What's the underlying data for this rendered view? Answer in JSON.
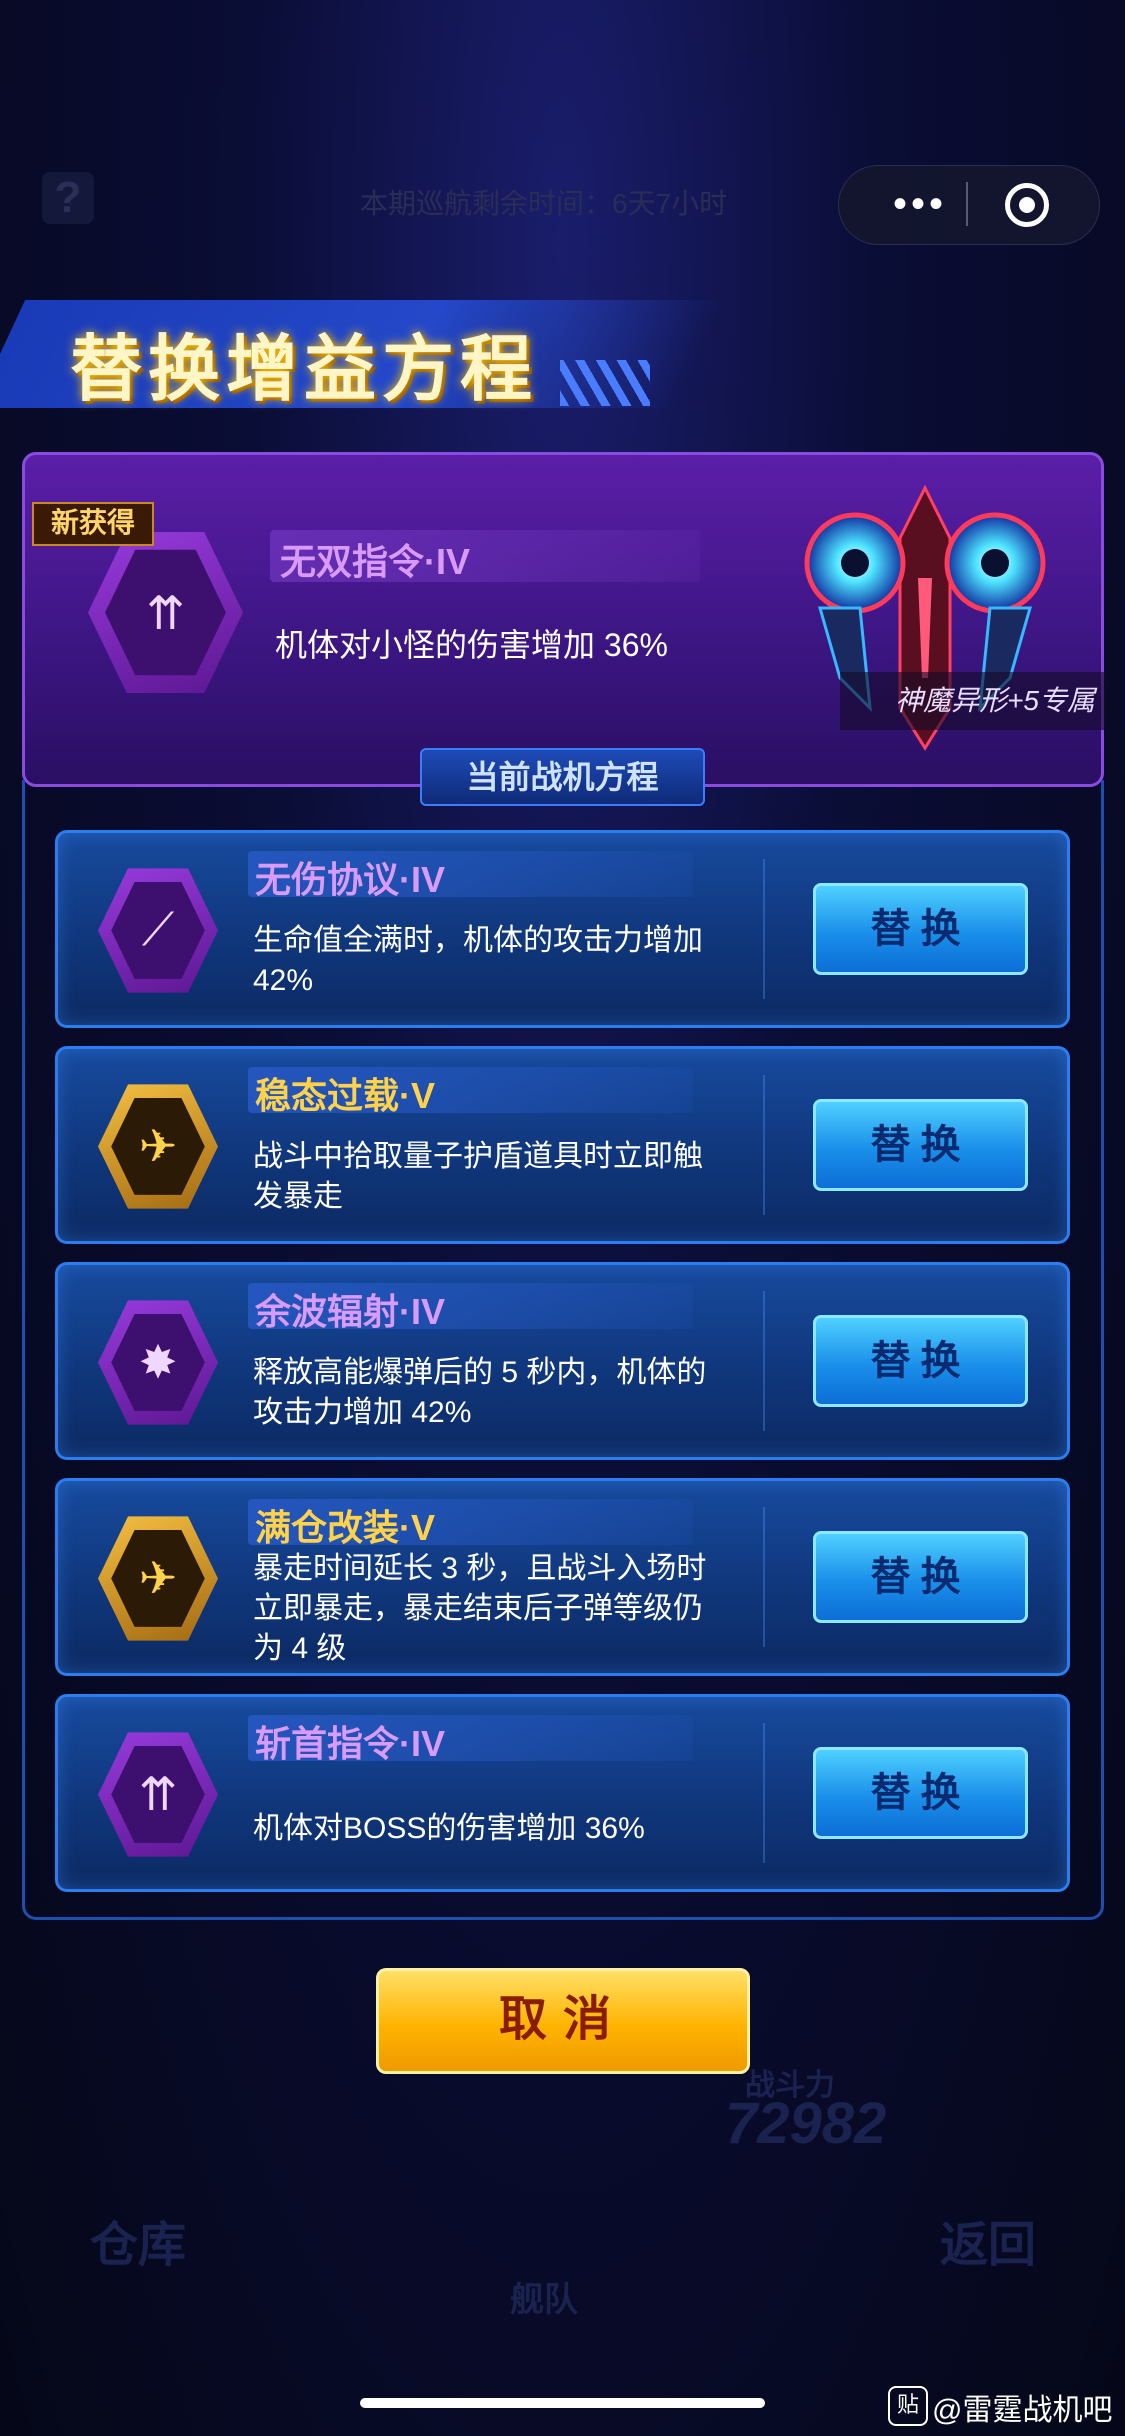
{
  "top_bar": {
    "help_glyph": "?",
    "cruise_text": "本期巡航剩余时间：6天7小时",
    "more_glyph": "•••"
  },
  "title": "替换增益方程",
  "new_item": {
    "tag": "新获得",
    "name": "无双指令·IV",
    "desc": "机体对小怪的伤害增加 36%",
    "ship_caption": "神魔异形+5专属",
    "icon": "fighter-arrows-icon"
  },
  "current_section_title": "当前战机方程",
  "cards": [
    {
      "name": "无伤协议·IV",
      "desc": "生命值全满时，机体的攻击力增加 42%",
      "button": "替换",
      "tier_color": "#d99bff",
      "icon": "slash-feather-icon"
    },
    {
      "name": "稳态过载·V",
      "desc": "战斗中拾取量子护盾道具时立即触发暴走",
      "button": "替换",
      "tier_color": "#ffd24a",
      "icon": "shield-fighter-icon"
    },
    {
      "name": "余波辐射·IV",
      "desc": "释放高能爆弹后的 5 秒内，机体的攻击力增加 42%",
      "button": "替换",
      "tier_color": "#d99bff",
      "icon": "blast-arrows-icon"
    },
    {
      "name": "满仓改装·V",
      "desc": "暴走时间延长 3 秒，且战斗入场时立即暴走，暴走结束后子弹等级仍为 4 级",
      "button": "替换",
      "tier_color": "#ffd24a",
      "icon": "winged-fighter-icon"
    },
    {
      "name": "斩首指令·IV",
      "desc": "机体对BOSS的伤害增加 36%",
      "button": "替换",
      "tier_color": "#d99bff",
      "icon": "mech-arrows-icon"
    }
  ],
  "cancel_label": "取消",
  "background": {
    "warehouse": "仓库",
    "back": "返回",
    "fleet": "舰队",
    "power_label": "战斗力",
    "power_value": "72982"
  },
  "watermark": "@雷霆战机吧",
  "watermark_logo": "贴"
}
